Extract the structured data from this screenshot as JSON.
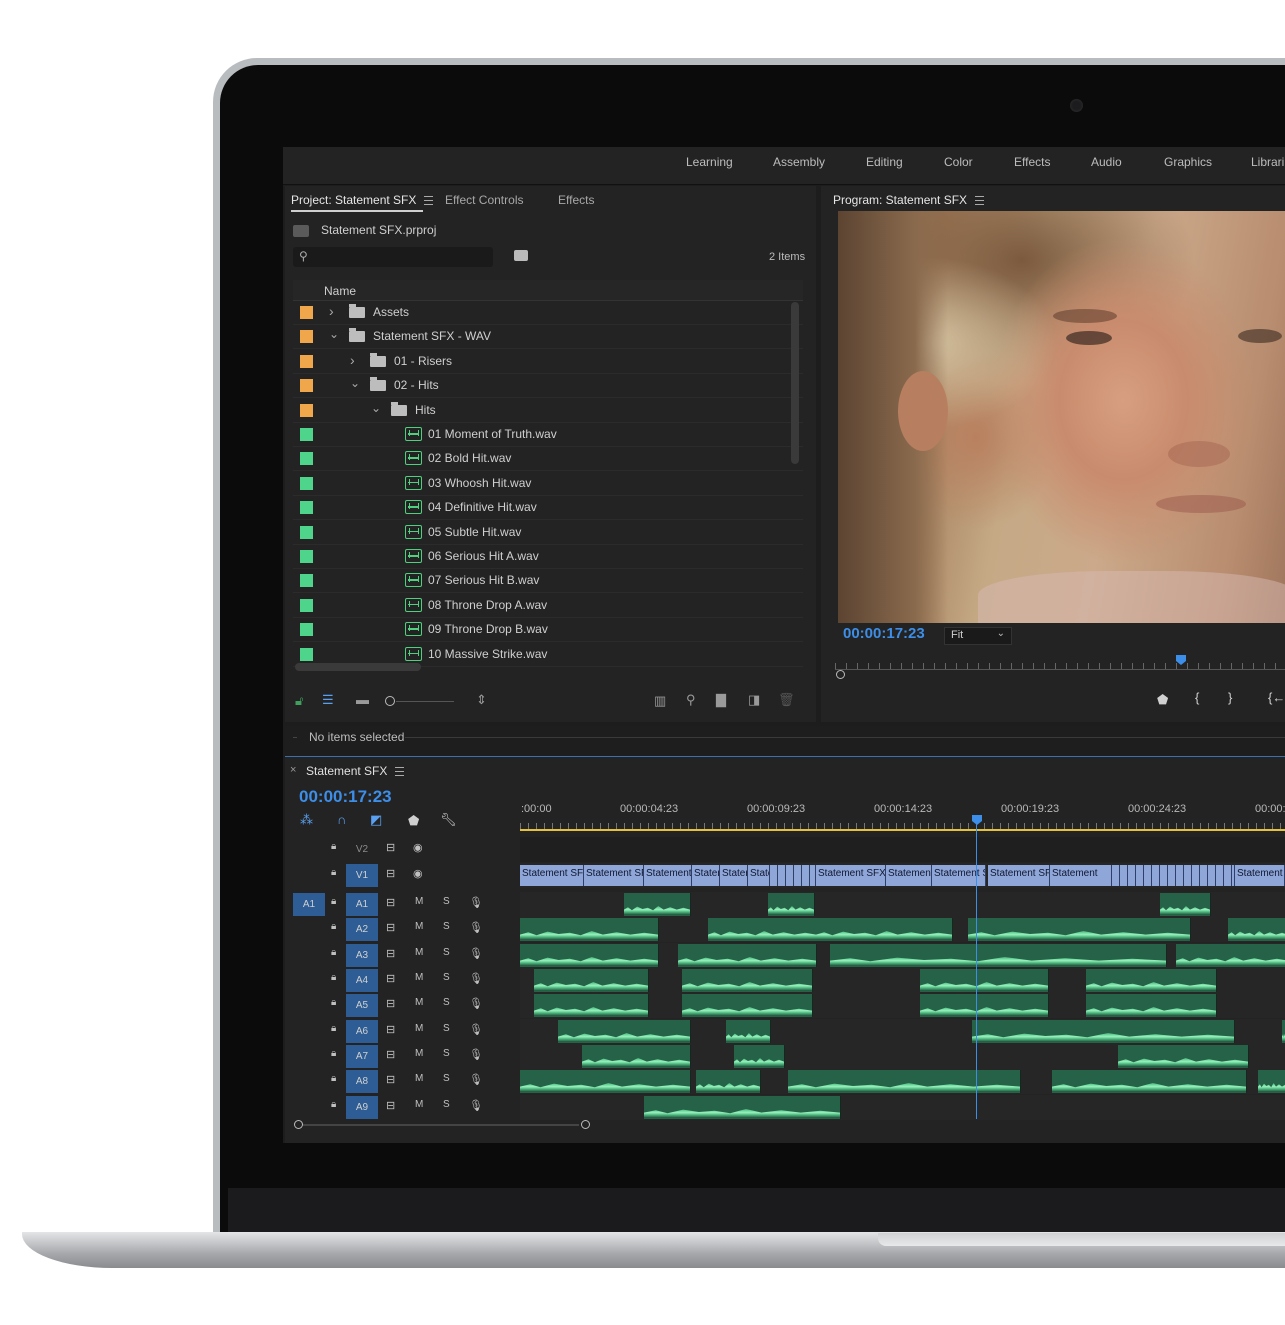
{
  "workspaces": [
    "Learning",
    "Assembly",
    "Editing",
    "Color",
    "Effects",
    "Audio",
    "Graphics",
    "Librari"
  ],
  "project": {
    "tabs": [
      "Project: Statement SFX",
      "Effect Controls",
      "Effects"
    ],
    "file_name": "Statement SFX.prproj",
    "item_count": "2 Items",
    "column_name": "Name",
    "items": [
      {
        "name": "Assets",
        "type": "folder",
        "indent": 0,
        "expanded": false,
        "color": "#f0a64a"
      },
      {
        "name": "Statement SFX - WAV",
        "type": "folder",
        "indent": 0,
        "expanded": true,
        "color": "#f0a64a"
      },
      {
        "name": "01 - Risers",
        "type": "folder",
        "indent": 1,
        "expanded": false,
        "color": "#f0a64a"
      },
      {
        "name": "02 - Hits",
        "type": "folder",
        "indent": 1,
        "expanded": true,
        "color": "#f0a64a"
      },
      {
        "name": "Hits",
        "type": "folder",
        "indent": 2,
        "expanded": true,
        "color": "#f0a64a"
      },
      {
        "name": "01 Moment of Truth.wav",
        "type": "audio",
        "indent": 3,
        "color": "#4fd58b"
      },
      {
        "name": "02 Bold Hit.wav",
        "type": "audio",
        "indent": 3,
        "color": "#4fd58b"
      },
      {
        "name": "03 Whoosh Hit.wav",
        "type": "audio",
        "indent": 3,
        "color": "#4fd58b"
      },
      {
        "name": "04 Definitive Hit.wav",
        "type": "audio",
        "indent": 3,
        "color": "#4fd58b"
      },
      {
        "name": "05 Subtle Hit.wav",
        "type": "audio",
        "indent": 3,
        "color": "#4fd58b"
      },
      {
        "name": "06 Serious Hit A.wav",
        "type": "audio",
        "indent": 3,
        "color": "#4fd58b"
      },
      {
        "name": "07 Serious Hit B.wav",
        "type": "audio",
        "indent": 3,
        "color": "#4fd58b"
      },
      {
        "name": "08 Throne Drop A.wav",
        "type": "audio",
        "indent": 3,
        "color": "#4fd58b"
      },
      {
        "name": "09 Throne Drop B.wav",
        "type": "audio",
        "indent": 3,
        "color": "#4fd58b"
      },
      {
        "name": "10 Massive Strike.wav",
        "type": "audio",
        "indent": 3,
        "color": "#4fd58b"
      }
    ]
  },
  "program": {
    "title": "Program: Statement SFX",
    "timecode": "00:00:17:23",
    "zoom": "Fit"
  },
  "info": {
    "status": "No items selected"
  },
  "timeline": {
    "title": "Statement SFX",
    "timecode": "00:00:17:23",
    "ruler": [
      ":00:00",
      "00:00:04:23",
      "00:00:09:23",
      "00:00:14:23",
      "00:00:19:23",
      "00:00:24:23",
      "00:00:"
    ],
    "source_patch": "A1",
    "video_tracks": [
      "V2",
      "V1"
    ],
    "audio_tracks": [
      "A1",
      "A2",
      "A3",
      "A4",
      "A5",
      "A6",
      "A7",
      "A8",
      "A9"
    ],
    "mute_label": "M",
    "solo_label": "S",
    "video_clips": [
      {
        "label": "Statement SFX"
      },
      {
        "label": "Statement SF"
      },
      {
        "label": "Statement"
      },
      {
        "label": "Staten"
      },
      {
        "label": "Stater"
      },
      {
        "label": "State"
      },
      {
        "label": "Statement SFX T"
      },
      {
        "label": "Statement"
      },
      {
        "label": "Statement SF"
      },
      {
        "label": "Statement SFX"
      },
      {
        "label": "Statement"
      },
      {
        "label": "Statement S"
      }
    ]
  },
  "colors": {
    "accent_blue": "#3d8ee8",
    "audio_green": "#4fd58b",
    "folder_orange": "#f0a64a",
    "playhead": "#3d8ee8"
  }
}
